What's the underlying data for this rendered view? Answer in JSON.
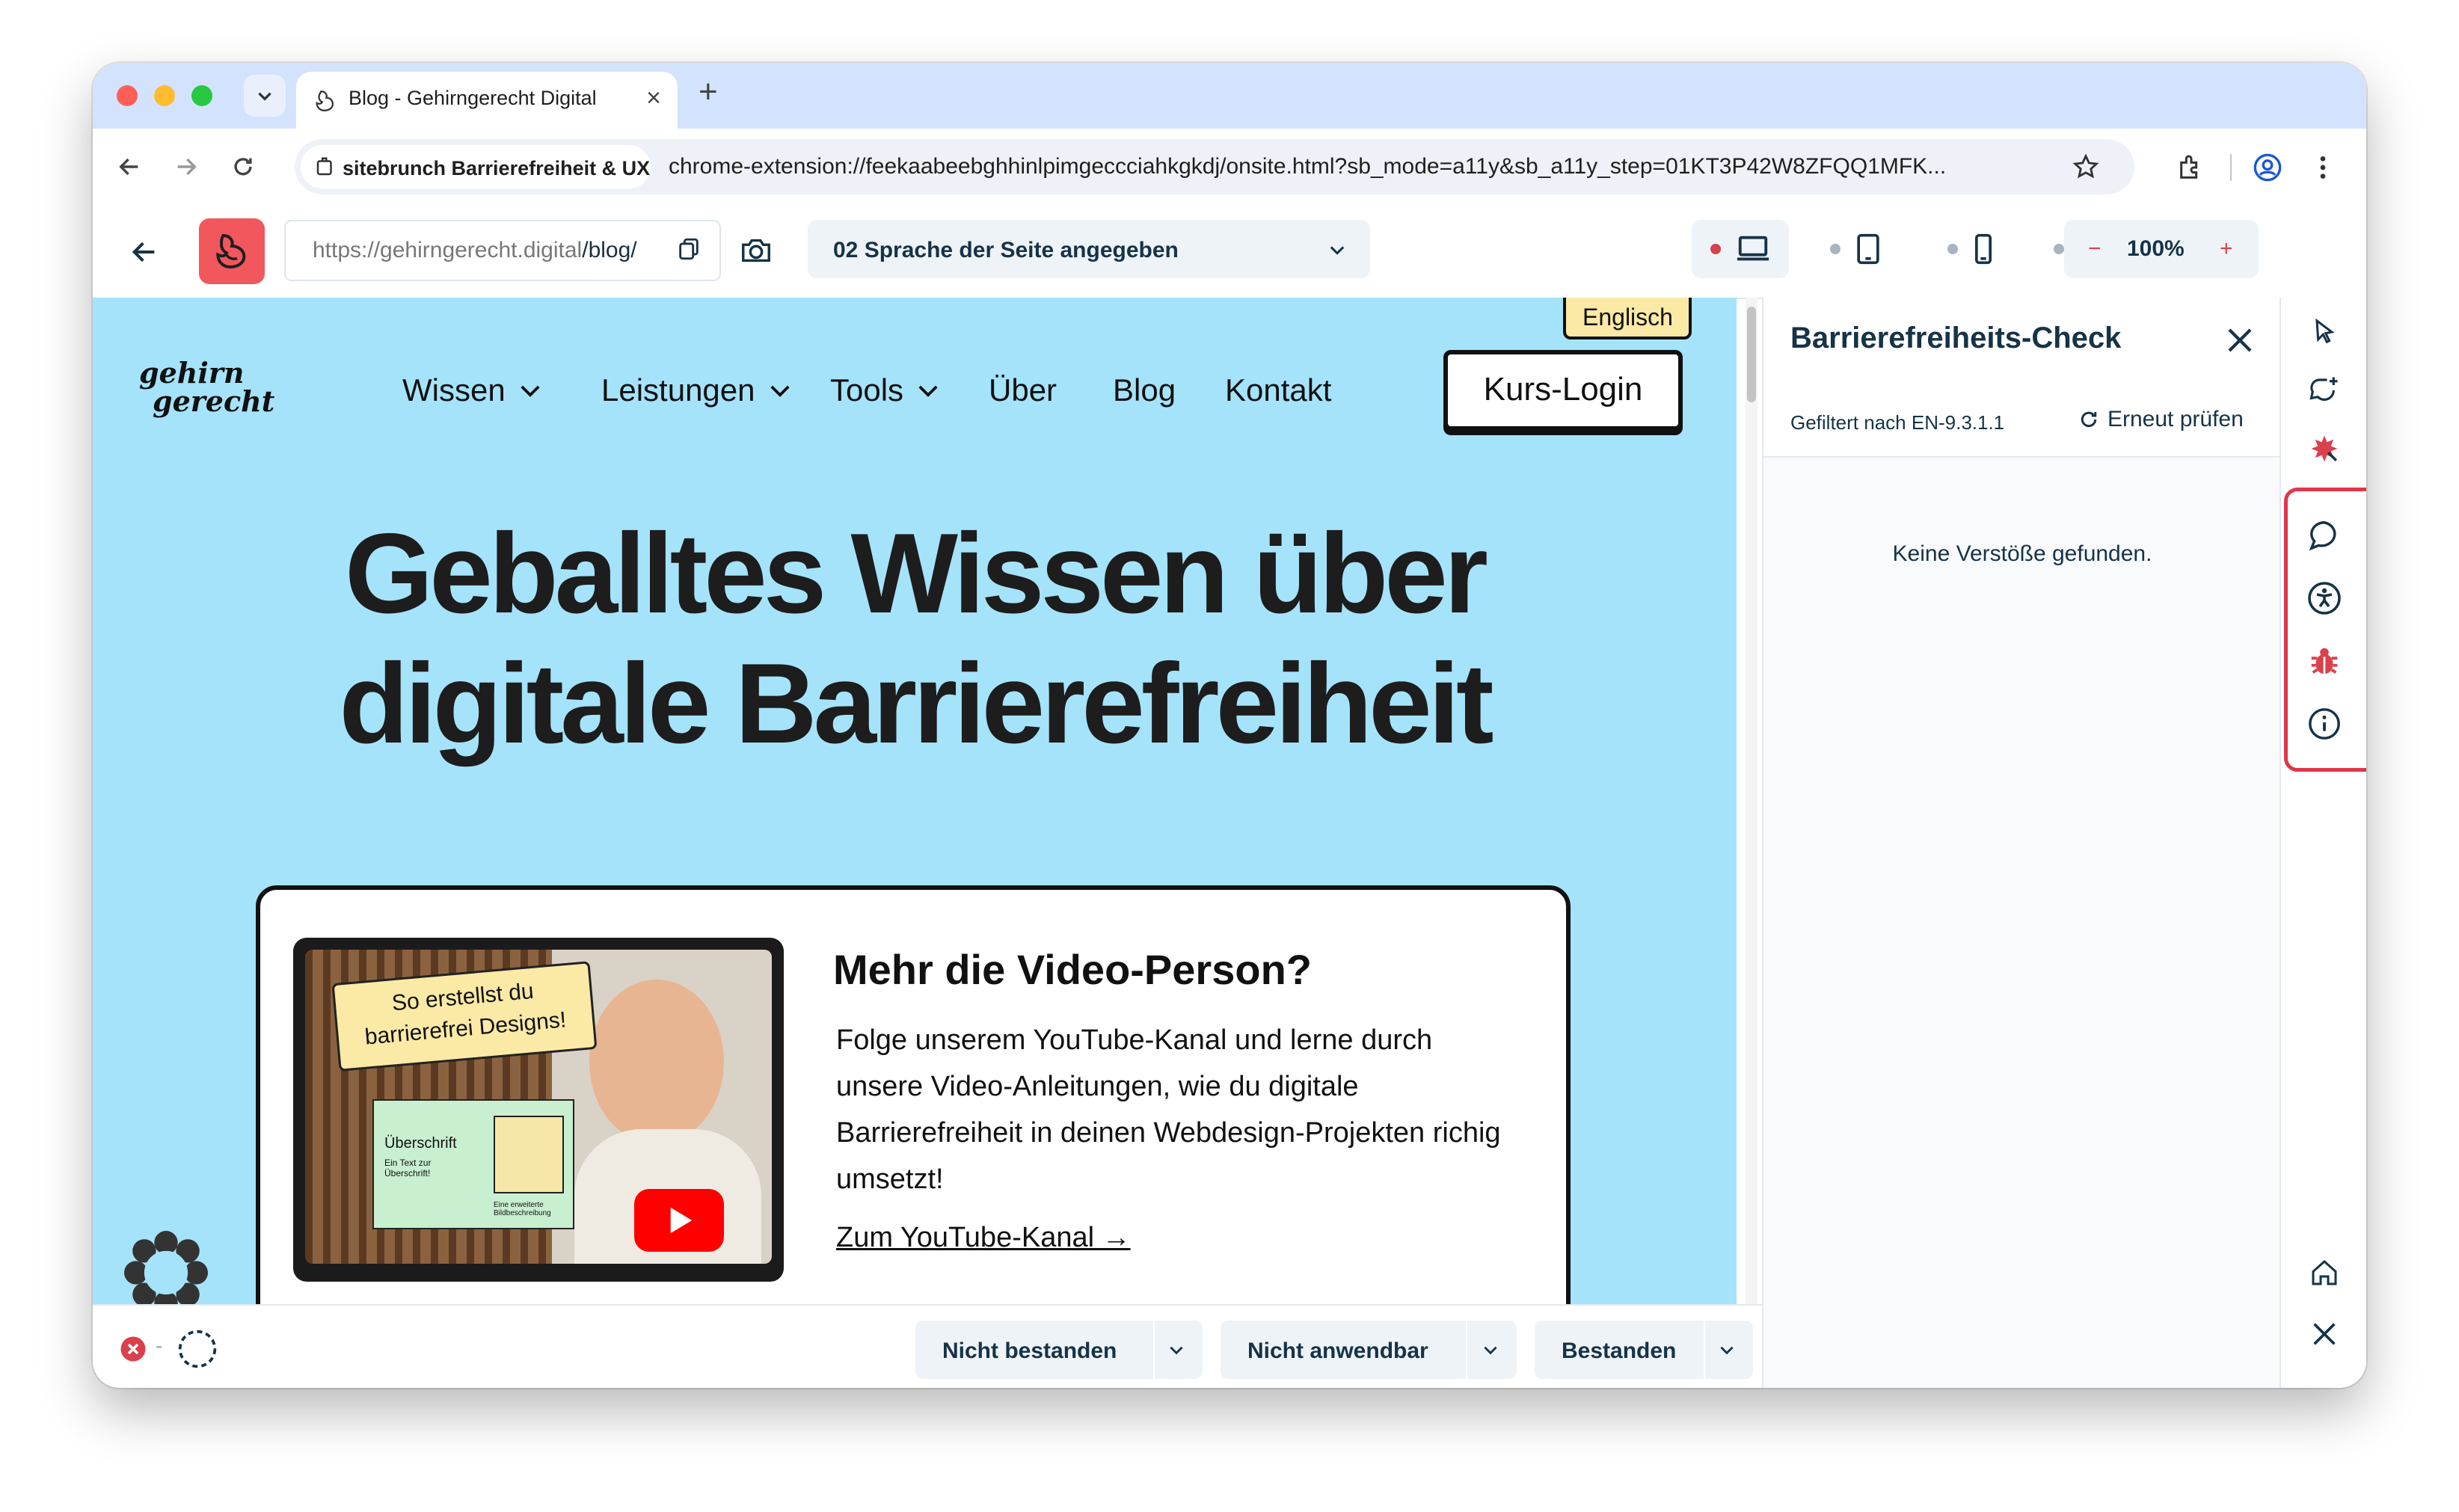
{
  "browser": {
    "tab_title": "Blog - Gehirngerecht Digital",
    "site_chip_label": "sitebrunch Barrierefreiheit & UX",
    "url": "chrome-extension://feekaabeebghhinlpimgeccciahkgkdj/onsite.html?sb_mode=a11y&sb_a11y_step=01KT3P42W8ZFQQ1MFK..."
  },
  "extension_bar": {
    "page_url_prefix": "https://gehirngerecht.digital",
    "page_url_path": "/blog/",
    "criterion": "02 Sprache der Seite angegeben",
    "zoom": "100%",
    "zoom_minus": "−",
    "zoom_plus": "+",
    "colors": {
      "active_dot": "#d9414c",
      "inactive_dot": "#a9b4bf",
      "accent": "#f2575d"
    }
  },
  "site": {
    "language_badge": "Englisch",
    "logo_line1": "gehirn",
    "logo_line2": "gerecht",
    "nav": [
      "Wissen",
      "Leistungen",
      "Tools",
      "Über",
      "Blog",
      "Kontakt"
    ],
    "login_label": "Kurs-Login",
    "hero_line1": "Geballtes Wissen über",
    "hero_line2": "digitale Barrierefreiheit",
    "card": {
      "thumb_caption": "So erstellst du barrierefrei Designs!",
      "thumb_label1": "Überschrift",
      "thumb_label2": "Ein Text zur Überschrift!",
      "thumb_label3": "Eine erweiterte Bildbeschreibung",
      "title": "Mehr die Video-Person?",
      "text": "Folge unserem YouTube-Kanal und lerne durch unsere Video-Anleitungen, wie du digitale Barrierefreiheit in deinen Webdesign-Projekten richig umsetzt!",
      "link": "Zum YouTube-Kanal →"
    },
    "bg_color": "#a5e3fb"
  },
  "bottom_bar": {
    "verdicts": [
      "Nicht bestanden",
      "Nicht anwendbar",
      "Bestanden"
    ],
    "separator": "-"
  },
  "panel": {
    "title": "Barrierefreiheits-Check",
    "filter_label": "Gefiltert nach EN-9.3.1.1",
    "recheck_label": "Erneut prüfen",
    "empty_message": "Keine Verstöße gefunden."
  }
}
